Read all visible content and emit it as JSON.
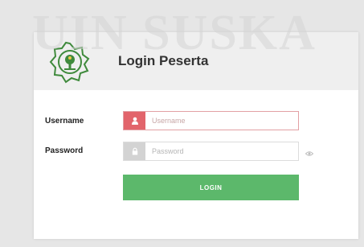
{
  "watermark": {
    "text": "UIN SUSKA"
  },
  "header": {
    "title": "Login Peserta",
    "logo_icon": "uin-suska-emblem-icon"
  },
  "form": {
    "username": {
      "label": "Username",
      "placeholder": "Username",
      "value": "",
      "icon": "user-icon",
      "accent": "#e2646b"
    },
    "password": {
      "label": "Password",
      "placeholder": "Password",
      "value": "",
      "icon": "lock-icon",
      "toggle_icon": "eye-icon",
      "accent": "#d3d3d3"
    },
    "submit_label": "LOGIN",
    "submit_color": "#5cb86b"
  }
}
